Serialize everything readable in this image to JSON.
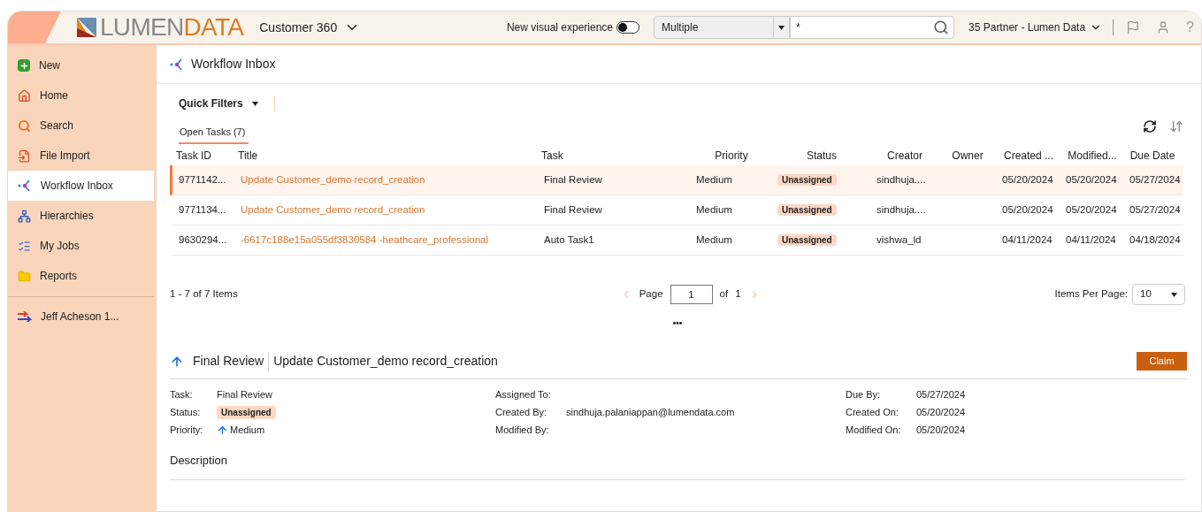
{
  "header": {
    "logo": {
      "part1": "LUMEN",
      "part2": "DATA"
    },
    "app_menu": "Customer 360",
    "toggle": {
      "label": "New visual experience",
      "on": false
    },
    "search_scope": "Multiple",
    "search_value": "*",
    "tenant": "35 Partner - Lumen Data",
    "help": "?"
  },
  "sidebar": {
    "items": [
      {
        "label": "New",
        "selected": false
      },
      {
        "label": "Home",
        "selected": false
      },
      {
        "label": "Search",
        "selected": false
      },
      {
        "label": "File Import",
        "selected": false
      },
      {
        "label": "Workflow Inbox",
        "selected": true
      },
      {
        "label": "Hierarchies",
        "selected": false
      },
      {
        "label": "My Jobs",
        "selected": false
      },
      {
        "label": "Reports",
        "selected": false
      }
    ],
    "user": "Jeff Acheson 1..."
  },
  "page_title": "Workflow Inbox",
  "quick_filters": "Quick Filters",
  "tabs": [
    {
      "label": "Open Tasks (7)",
      "selected": true
    }
  ],
  "table": {
    "columns": [
      "Task ID",
      "Title",
      "Task",
      "Priority",
      "Status",
      "Creator",
      "Owner",
      "Created ...",
      "Modified...",
      "Due Date"
    ],
    "rows": [
      {
        "selected": true,
        "cells": [
          "9771142...",
          "Update Customer_demo record_creation",
          "Final Review",
          "Medium",
          "Unassigned",
          "sindhuja....",
          "",
          "05/20/2024",
          "05/20/2024",
          "05/27/2024"
        ]
      },
      {
        "selected": false,
        "cells": [
          "9771134...",
          "Update Customer_demo record_creation",
          "Final Review",
          "Medium",
          "Unassigned",
          "sindhuja....",
          "",
          "05/20/2024",
          "05/20/2024",
          "05/27/2024"
        ]
      },
      {
        "selected": false,
        "cells": [
          "9630294...",
          "-6617c188e15a055df3830584 -heathcare_professional",
          "Auto Task1",
          "Medium",
          "Unassigned",
          "vishwa_ld",
          "",
          "04/11/2024",
          "04/11/2024",
          "04/18/2024"
        ]
      }
    ]
  },
  "pager": {
    "summary": "1 - 7 of 7 Items",
    "page_label": "Page",
    "page": "1",
    "of_label": "of",
    "total": "1",
    "per_page_label": "Items Per Page:",
    "per_page": "10"
  },
  "more": "•••",
  "detail": {
    "task": "Final Review",
    "title": "Update Customer_demo record_creation",
    "claim": "Claim",
    "fields": [
      [
        {
          "label": "Task:",
          "value": "Final Review",
          "kind": "text"
        },
        {
          "label": "Status:",
          "value": "Unassigned",
          "kind": "badge"
        },
        {
          "label": "Priority:",
          "value": "Medium",
          "kind": "priority"
        }
      ],
      [
        {
          "label": "Assigned To:"
        },
        {
          "label": "Created By:",
          "value": "sindhuja.palaniappan@lumendata.com",
          "kind": "text"
        },
        {
          "label": "Modified By:"
        }
      ],
      [
        {
          "label": "Due By:",
          "value": "05/27/2024",
          "kind": "text"
        },
        {
          "label": "Created On:",
          "value": "05/20/2024",
          "kind": "text"
        },
        {
          "label": "Modified On:",
          "value": "05/20/2024",
          "kind": "text"
        }
      ]
    ],
    "description_label": "Description"
  }
}
